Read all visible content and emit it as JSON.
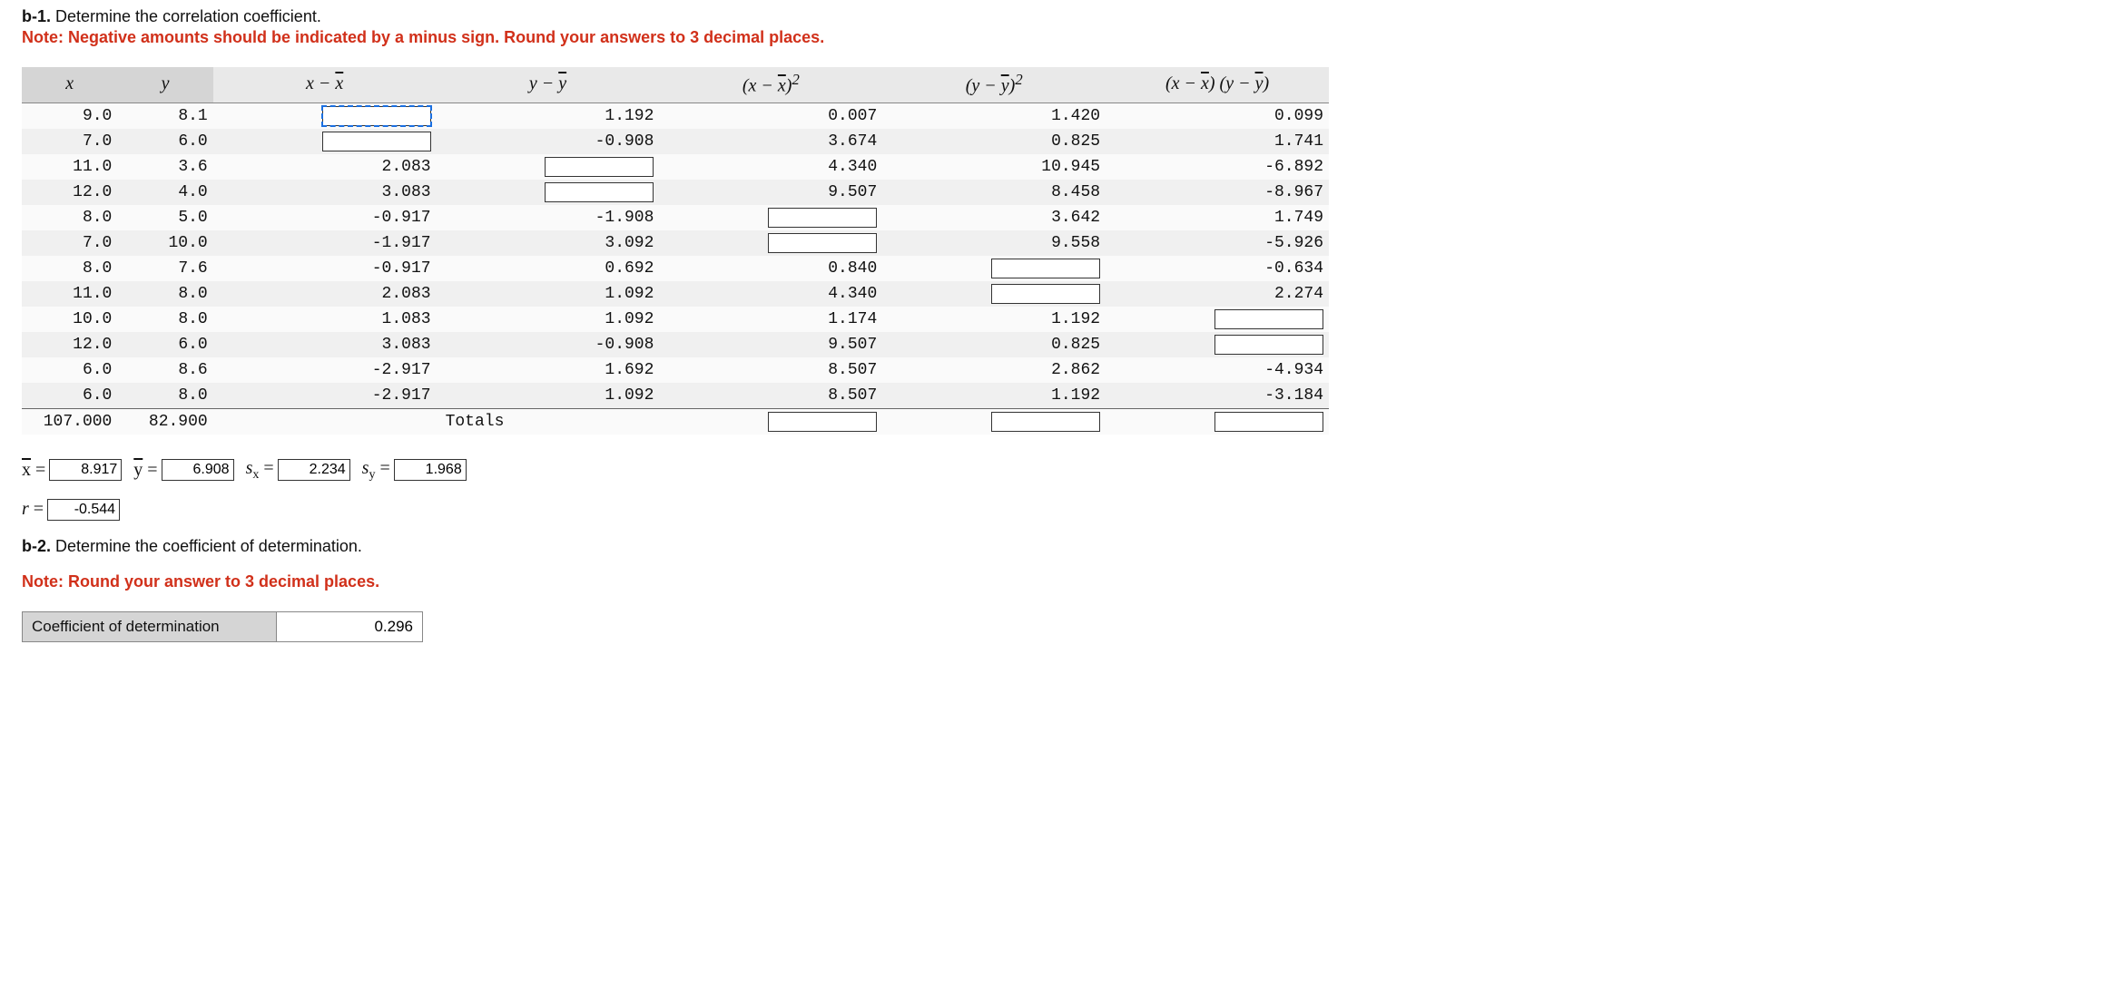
{
  "b1": {
    "title_prefix": "b-1.",
    "title_rest": " Determine the correlation coefficient.",
    "note": "Note: Negative amounts should be indicated by a minus sign. Round your answers to 3 decimal places."
  },
  "headers": {
    "x": "x",
    "y": "y",
    "xmx": "x − x̄",
    "ymy": "y − ȳ",
    "xmx2": "(x − x̄)²",
    "ymy2": "(y − ȳ)²",
    "prod": "(x − x̄) (y − ȳ)"
  },
  "rows": [
    {
      "x": "9.0",
      "y": "8.1",
      "xmx": "",
      "xmx_blank": true,
      "xmx_active": true,
      "ymy": "1.192",
      "xmx2": "0.007",
      "ymy2": "1.420",
      "prod": "0.099"
    },
    {
      "x": "7.0",
      "y": "6.0",
      "xmx": "",
      "xmx_blank": true,
      "ymy": "-0.908",
      "xmx2": "3.674",
      "ymy2": "0.825",
      "prod": "1.741"
    },
    {
      "x": "11.0",
      "y": "3.6",
      "xmx": "2.083",
      "ymy": "",
      "ymy_blank": true,
      "xmx2": "4.340",
      "ymy2": "10.945",
      "prod": "-6.892"
    },
    {
      "x": "12.0",
      "y": "4.0",
      "xmx": "3.083",
      "ymy": "",
      "ymy_blank": true,
      "xmx2": "9.507",
      "ymy2": "8.458",
      "prod": "-8.967"
    },
    {
      "x": "8.0",
      "y": "5.0",
      "xmx": "-0.917",
      "ymy": "-1.908",
      "xmx2": "",
      "xmx2_blank": true,
      "ymy2": "3.642",
      "prod": "1.749"
    },
    {
      "x": "7.0",
      "y": "10.0",
      "xmx": "-1.917",
      "ymy": "3.092",
      "xmx2": "",
      "xmx2_blank": true,
      "ymy2": "9.558",
      "prod": "-5.926"
    },
    {
      "x": "8.0",
      "y": "7.6",
      "xmx": "-0.917",
      "ymy": "0.692",
      "xmx2": "0.840",
      "ymy2": "",
      "ymy2_blank": true,
      "prod": "-0.634"
    },
    {
      "x": "11.0",
      "y": "8.0",
      "xmx": "2.083",
      "ymy": "1.092",
      "xmx2": "4.340",
      "ymy2": "",
      "ymy2_blank": true,
      "prod": "2.274"
    },
    {
      "x": "10.0",
      "y": "8.0",
      "xmx": "1.083",
      "ymy": "1.092",
      "xmx2": "1.174",
      "ymy2": "1.192",
      "prod": "",
      "prod_blank": true
    },
    {
      "x": "12.0",
      "y": "6.0",
      "xmx": "3.083",
      "ymy": "-0.908",
      "xmx2": "9.507",
      "ymy2": "0.825",
      "prod": "",
      "prod_blank": true
    },
    {
      "x": "6.0",
      "y": "8.6",
      "xmx": "-2.917",
      "ymy": "1.692",
      "xmx2": "8.507",
      "ymy2": "2.862",
      "prod": "-4.934"
    },
    {
      "x": "6.0",
      "y": "8.0",
      "xmx": "-2.917",
      "ymy": "1.092",
      "xmx2": "8.507",
      "ymy2": "1.192",
      "prod": "-3.184"
    }
  ],
  "totals": {
    "x": "107.000",
    "y": "82.900",
    "label": "Totals",
    "xmx2": "",
    "ymy2": "",
    "prod": ""
  },
  "stats": {
    "xbar_label": "x̄ =",
    "xbar": "8.917",
    "ybar_label": "ȳ =",
    "ybar": "6.908",
    "sx_label": "sₓ =",
    "sx": "2.234",
    "sy_label": "sᵧ =",
    "sy": "1.968",
    "r_label": "r =",
    "r": "-0.544"
  },
  "b2": {
    "title_prefix": "b-2.",
    "title_rest": " Determine the coefficient of determination.",
    "note": "Note: Round your answer to 3 decimal places.",
    "label": "Coefficient of determination",
    "value": "0.296"
  }
}
